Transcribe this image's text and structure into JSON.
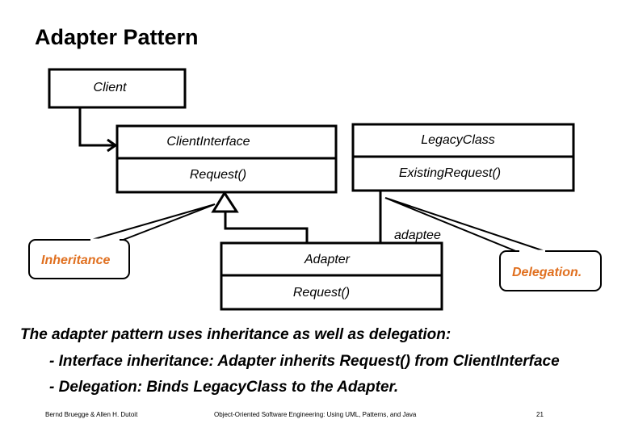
{
  "slide": {
    "title": "Adapter Pattern",
    "accent_color": "#e07020"
  },
  "diagram": {
    "classes": {
      "client": {
        "name": "Client"
      },
      "client_interface": {
        "name": "ClientInterface",
        "operation": "Request()"
      },
      "legacy_class": {
        "name": "LegacyClass",
        "operation": "ExistingRequest()"
      },
      "adapter": {
        "name": "Adapter",
        "operation": "Request()"
      }
    },
    "association_label": "adaptee",
    "callouts": {
      "inheritance": "Inheritance",
      "delegation": "Delegation."
    }
  },
  "body": {
    "lines": [
      "The adapter pattern uses inheritance as well as delegation:",
      "- Interface inheritance: Adapter inherits Request() from ClientInterface",
      "- Delegation: Binds LegacyClass to the Adapter."
    ]
  },
  "footer": {
    "authors": "Bernd Bruegge & Allen H. Dutoit",
    "book": "Object-Oriented Software Engineering: Using UML, Patterns, and Java",
    "page_number": "21"
  }
}
